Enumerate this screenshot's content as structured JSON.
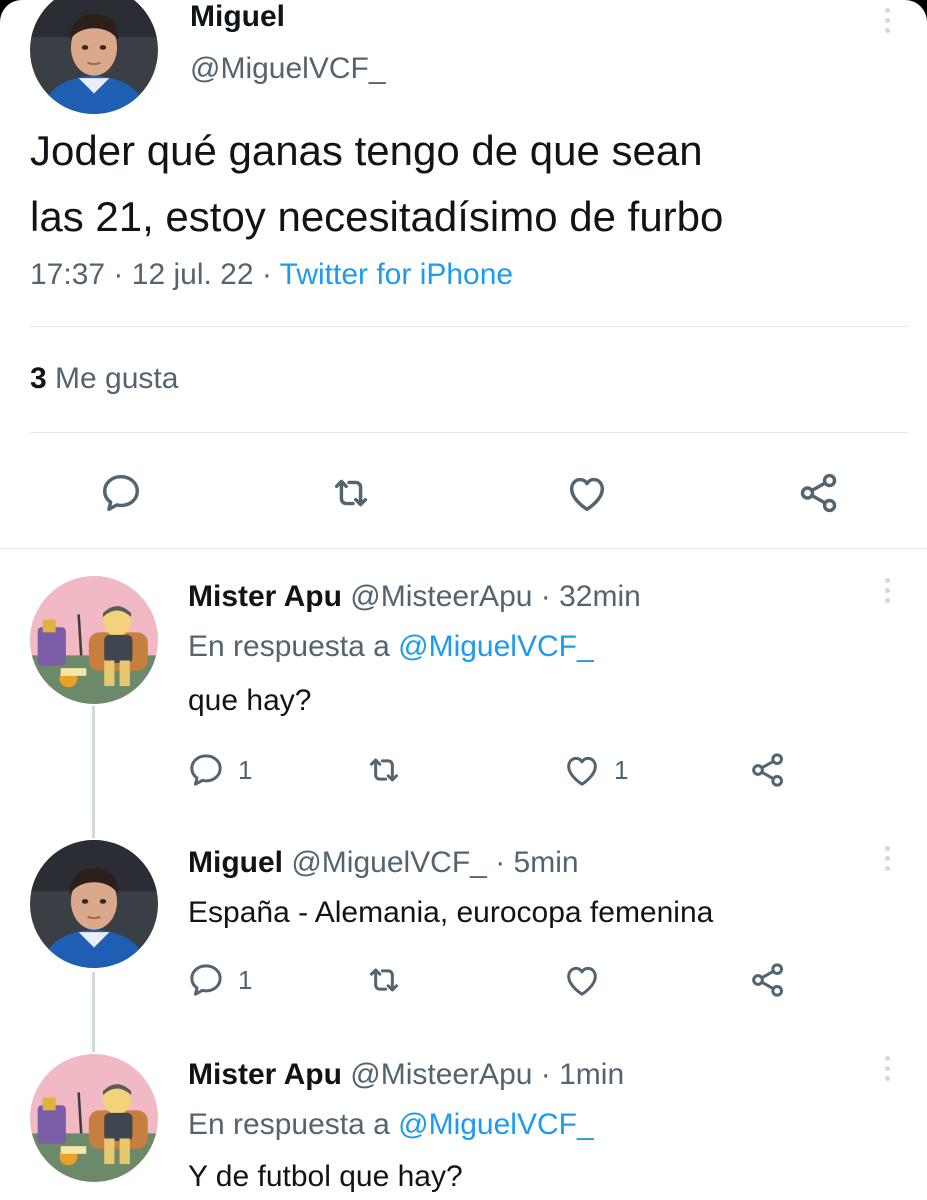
{
  "main_tweet": {
    "name": "Miguel",
    "handle": "@MiguelVCF_",
    "text_line1": "Joder qué ganas tengo de que sean",
    "text_line2": "las 21, estoy necesitadísimo de furbo",
    "time": "17:37",
    "date": "12 jul. 22",
    "sep": "·",
    "source": "Twitter for iPhone",
    "likes_count": "3",
    "likes_label": "Me gusta"
  },
  "replies": [
    {
      "name": "Mister Apu",
      "handle": "@MisteerApu",
      "sep": "·",
      "time": "32min",
      "reply_prefix": "En respuesta a",
      "reply_mention": "@MiguelVCF_",
      "text": "que hay?",
      "reply_count": "1",
      "like_count": "1"
    },
    {
      "name": "Miguel",
      "handle": "@MiguelVCF_",
      "sep": "·",
      "time": "5min",
      "text": "España - Alemania, eurocopa femenina",
      "reply_count": "1"
    },
    {
      "name": "Mister Apu",
      "handle": "@MisteerApu",
      "sep": "·",
      "time": "1min",
      "reply_prefix": "En respuesta a",
      "reply_mention": "@MiguelVCF_",
      "text": "Y de futbol que hay?"
    }
  ],
  "colors": {
    "text": "#0f1419",
    "secondary": "#536471",
    "link": "#1d9bf0",
    "divider": "#e4e7ea"
  },
  "icons": [
    "reply-icon",
    "retweet-icon",
    "like-icon",
    "share-icon",
    "more-icon"
  ]
}
